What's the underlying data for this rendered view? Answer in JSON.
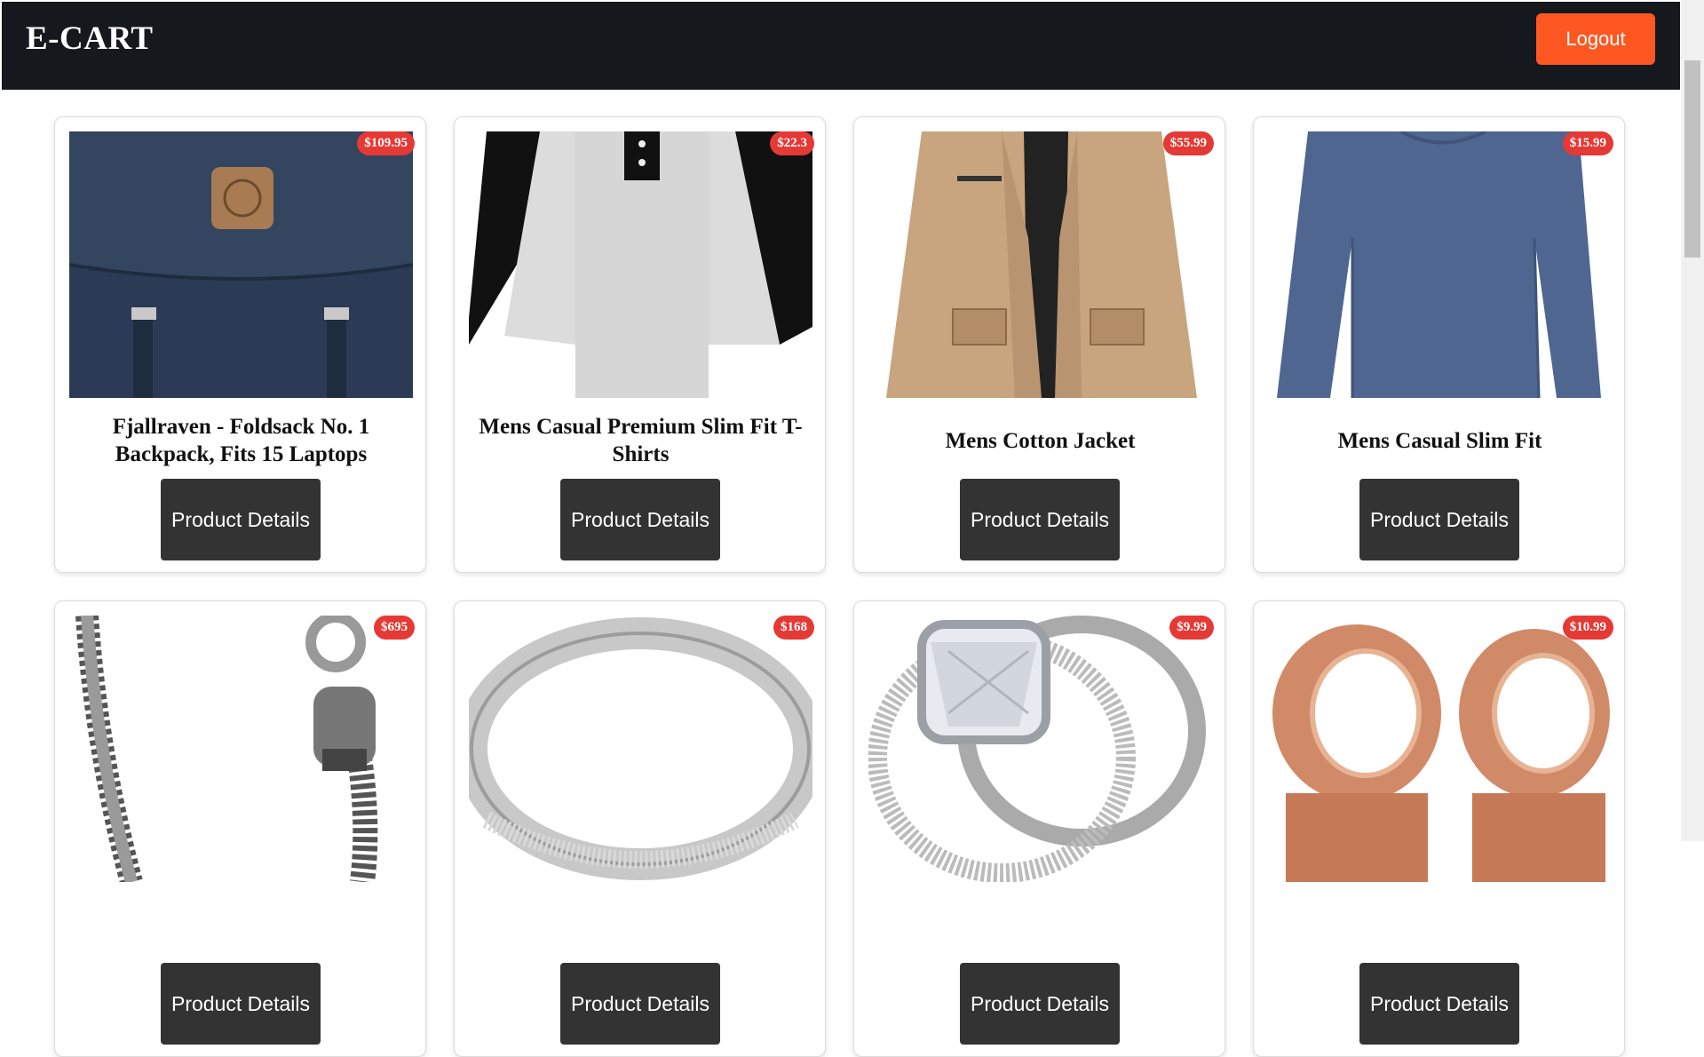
{
  "header": {
    "brand": "E-CART",
    "logout_label": "Logout"
  },
  "colors": {
    "header_bg": "#15191d",
    "accent": "#fe5722",
    "price_badge": "#e53935",
    "button_bg": "#333333"
  },
  "products": [
    {
      "title": "Fjallraven - Foldsack No. 1 Backpack, Fits 15 Laptops",
      "price": "$109.95",
      "button_label": "Product Details",
      "image": "backpack"
    },
    {
      "title": "Mens Casual Premium Slim Fit T-Shirts",
      "price": "$22.3",
      "button_label": "Product Details",
      "image": "raglan-tshirt"
    },
    {
      "title": "Mens Cotton Jacket",
      "price": "$55.99",
      "button_label": "Product Details",
      "image": "cotton-jacket"
    },
    {
      "title": "Mens Casual Slim Fit",
      "price": "$15.99",
      "button_label": "Product Details",
      "image": "long-sleeve-shirt"
    },
    {
      "title": "",
      "price": "$695",
      "button_label": "Product Details",
      "image": "chain-bracelet"
    },
    {
      "title": "",
      "price": "$168",
      "button_label": "Product Details",
      "image": "silver-ring"
    },
    {
      "title": "",
      "price": "$9.99",
      "button_label": "Product Details",
      "image": "diamond-ring-set"
    },
    {
      "title": "",
      "price": "$10.99",
      "button_label": "Product Details",
      "image": "rose-gold-plugs"
    }
  ]
}
